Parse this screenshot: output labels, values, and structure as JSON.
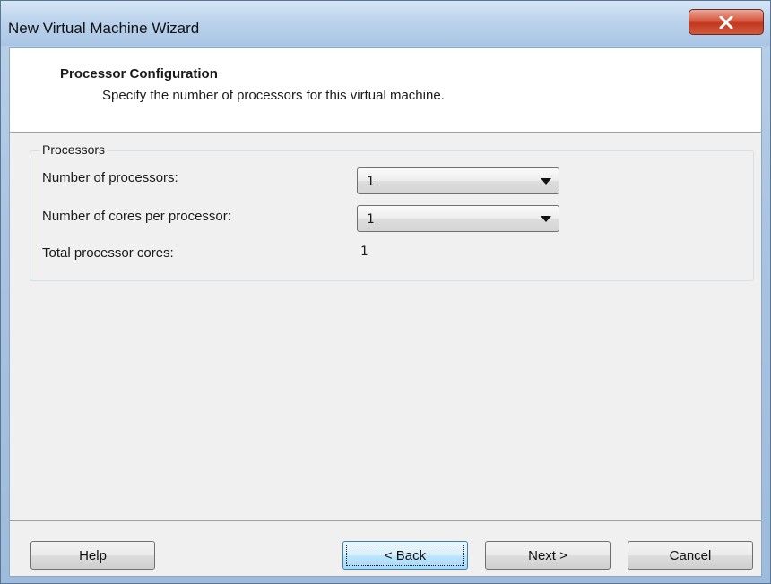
{
  "window": {
    "title": "New Virtual Machine Wizard"
  },
  "header": {
    "title": "Processor Configuration",
    "subtitle": "Specify the number of processors for this virtual machine."
  },
  "processors_group": {
    "legend": "Processors",
    "num_processors_label": "Number of processors:",
    "num_processors_value": "1",
    "cores_per_processor_label": "Number of cores per processor:",
    "cores_per_processor_value": "1",
    "total_cores_label": "Total processor cores:",
    "total_cores_value": "1"
  },
  "buttons": {
    "help": "Help",
    "back": "< Back",
    "next": "Next >",
    "cancel": "Cancel"
  },
  "icons": {
    "close": "close-icon",
    "dropdown": "chevron-down-icon"
  },
  "colors": {
    "titlebar": "#bcd3ec",
    "close_button": "#d05a3e",
    "focused_button": "#bee6fd",
    "dialog_background": "#f0f0f0"
  }
}
